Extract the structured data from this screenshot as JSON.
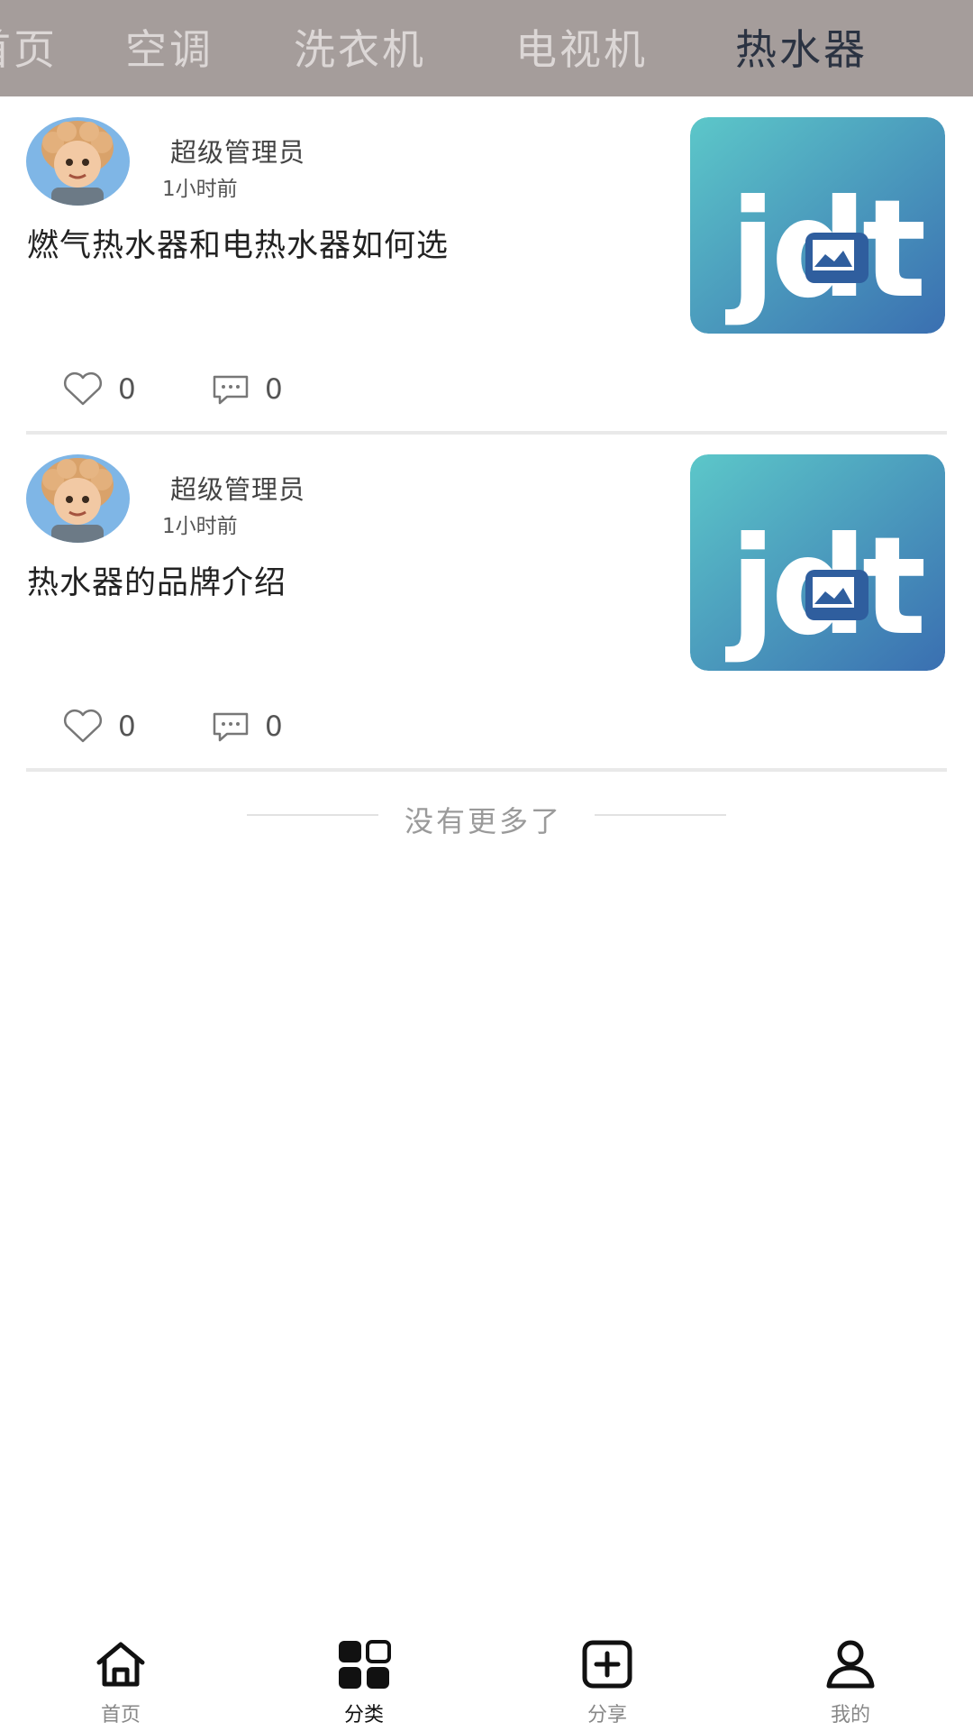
{
  "tabs": [
    {
      "label": "首页"
    },
    {
      "label": "空调"
    },
    {
      "label": "洗衣机"
    },
    {
      "label": "电视机"
    },
    {
      "label": "热水器",
      "active": true
    }
  ],
  "posts": [
    {
      "author": "超级管理员",
      "time": "1小时前",
      "title": "燃气热水器和电热水器如何选",
      "thumb_text": "jdt",
      "likes": "0",
      "comments": "0"
    },
    {
      "author": "超级管理员",
      "time": "1小时前",
      "title": "热水器的品牌介绍",
      "thumb_text": "jdt",
      "likes": "0",
      "comments": "0"
    }
  ],
  "list_end": "没有更多了",
  "bottom_nav": [
    {
      "label": "首页",
      "icon": "home-icon"
    },
    {
      "label": "分类",
      "icon": "grid-icon",
      "active": true
    },
    {
      "label": "分享",
      "icon": "plus-square-icon"
    },
    {
      "label": "我的",
      "icon": "user-icon"
    }
  ],
  "colors": {
    "tabbar_bg": "#a59d9b",
    "tab_active": "#2b3342",
    "thumb_teal": "#56c1c6",
    "thumb_blue": "#3a76b3"
  }
}
